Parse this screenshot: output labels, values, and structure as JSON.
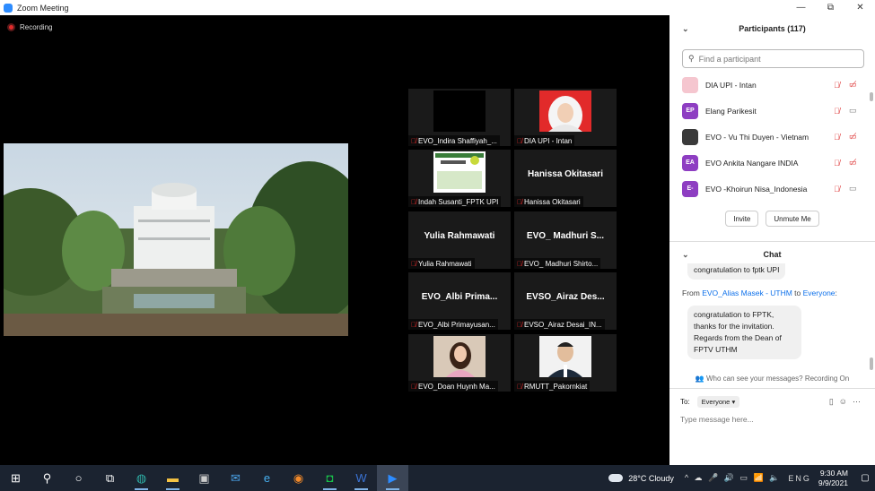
{
  "window": {
    "title": "Zoom Meeting",
    "controls": [
      "—",
      "⧉",
      "✕"
    ]
  },
  "meeting": {
    "recording_label": "Recording",
    "tiles": [
      {
        "name": "EVO_Indira Shaffiyah_...",
        "type": "black"
      },
      {
        "name": "DIA UPI - Intan",
        "type": "hijab"
      },
      {
        "name": "Indah Susanti_FPTK UPI",
        "type": "poster"
      },
      {
        "name": "Hanissa Okitasari",
        "type": "text",
        "display": "Hanissa Okitasari"
      },
      {
        "name": "Yulia Rahmawati",
        "type": "text",
        "display": "Yulia Rahmawati"
      },
      {
        "name": "EVO_ Madhuri Shirto...",
        "type": "text",
        "display": "EVO_ Madhuri S..."
      },
      {
        "name": "EVO_Albi Primayusan...",
        "type": "text",
        "display": "EVO_Albi  Prima..."
      },
      {
        "name": "EVSO_Airaz Desai_IN...",
        "type": "text",
        "display": "EVSO_Airaz  Des..."
      },
      {
        "name": "EVO_Doan Huynh Ma...",
        "type": "woman"
      },
      {
        "name": "RMUTT_Pakornkiat",
        "type": "man"
      }
    ]
  },
  "participants": {
    "header": "Participants (117)",
    "search_placeholder": "Find a participant",
    "items": [
      {
        "name": "DIA UPI - Intan",
        "initials": "",
        "color": "#f5c6cf",
        "cam_on": false
      },
      {
        "name": "Elang Parikesit",
        "initials": "EP",
        "color": "#8e3ec2",
        "cam_on": true
      },
      {
        "name": "EVO - Vu Thi Duyen - Vietnam",
        "initials": "",
        "color": "#3a3a3a",
        "cam_on": false
      },
      {
        "name": "EVO Ankita Nangare INDIA",
        "initials": "EA",
        "color": "#8e3ec2",
        "cam_on": false
      },
      {
        "name": "EVO -Khoirun Nisa_Indonesia",
        "initials": "E-",
        "color": "#8e3ec2",
        "cam_on": true
      }
    ],
    "invite_label": "Invite",
    "unmute_label": "Unmute Me"
  },
  "chat": {
    "header": "Chat",
    "prev_message": "congratulation to fptk UPI",
    "from_prefix": "From ",
    "from_name": "EVO_Alias Masek - UTHM",
    "from_to": " to ",
    "to_name": "Everyone",
    "from_suffix": ":",
    "message": "congratulation to FPTK, thanks for the invitation. Regards from the Dean of FPTV UTHM",
    "who_can_see": "Who can see your messages? Recording On",
    "to_label": "To:",
    "to_value": "Everyone ▾",
    "input_placeholder": "Type message here..."
  },
  "taskbar": {
    "weather": "28°C  Cloudy",
    "lang": "ENG",
    "time": "9:30 AM",
    "date": "9/9/2021"
  }
}
